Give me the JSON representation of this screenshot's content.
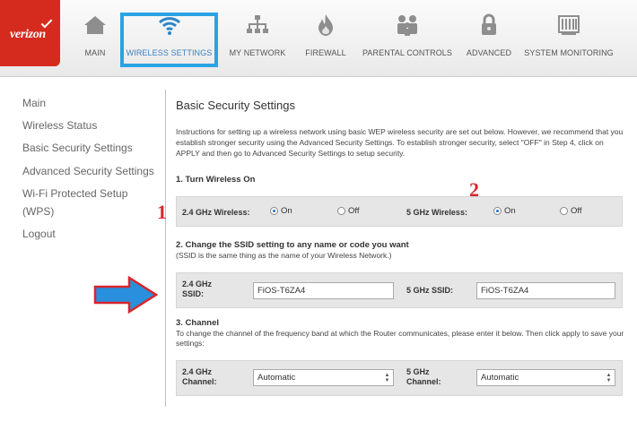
{
  "brand": {
    "logo_text": "verizon",
    "accent": "#d52b1e",
    "highlight": "#2aa3e3"
  },
  "nav": {
    "items": [
      {
        "label": "MAIN",
        "icon": "home-icon"
      },
      {
        "label": "WIRELESS SETTINGS",
        "icon": "wifi-icon",
        "active": true
      },
      {
        "label": "MY NETWORK",
        "icon": "network-icon"
      },
      {
        "label": "FIREWALL",
        "icon": "flame-icon"
      },
      {
        "label": "PARENTAL CONTROLS",
        "icon": "family-icon"
      },
      {
        "label": "ADVANCED",
        "icon": "lock-icon"
      },
      {
        "label": "SYSTEM MONITORING",
        "icon": "monitor-icon"
      }
    ]
  },
  "sidebar": {
    "items": [
      {
        "label": "Main"
      },
      {
        "label": "Wireless Status"
      },
      {
        "label": "Basic Security Settings"
      },
      {
        "label": "Advanced Security Settings"
      },
      {
        "label": "Wi-Fi Protected Setup"
      },
      {
        "label": "(WPS)"
      },
      {
        "label": "Logout"
      }
    ]
  },
  "main": {
    "title": "Basic Security Settings",
    "intro": "Instructions for setting up a wireless network using basic WEP wireless security are set out below. However, we recommend that you establish stronger security using the Advanced Security Settings. To establish stronger security, select \"OFF\" in Step 4, click on APPLY and then go to Advanced Security Settings to setup security.",
    "step1": {
      "title": "1. Turn Wireless On",
      "label_24": "2.4 GHz Wireless:",
      "label_5": "5 GHz Wireless:",
      "on": "On",
      "off": "Off",
      "value_24": "On",
      "value_5": "On"
    },
    "step2": {
      "title": "2. Change the SSID setting to any name or code you want",
      "subtitle": "(SSID is the same thing as the name of your Wireless Network.)",
      "label_24_line1": "2.4 GHz",
      "label_24_line2": "SSID:",
      "label_5": "5 GHz SSID:",
      "ssid_24": "FiOS-T6ZA4",
      "ssid_5": "FiOS-T6ZA4"
    },
    "step3": {
      "title": "3. Channel",
      "subtitle": "To change the channel of the frequency band at which the Router communicates, please enter it below. Then click apply to save your settings:",
      "label_24_line1": "2.4 GHz",
      "label_24_line2": "Channel:",
      "label_5_line1": "5 GHz",
      "label_5_line2": "Channel:",
      "channel_24": "Automatic",
      "channel_5": "Automatic"
    }
  },
  "annotations": {
    "num1": "1",
    "num2": "2",
    "color": "#d6272e",
    "arrow_color": "#2a8fdc"
  }
}
